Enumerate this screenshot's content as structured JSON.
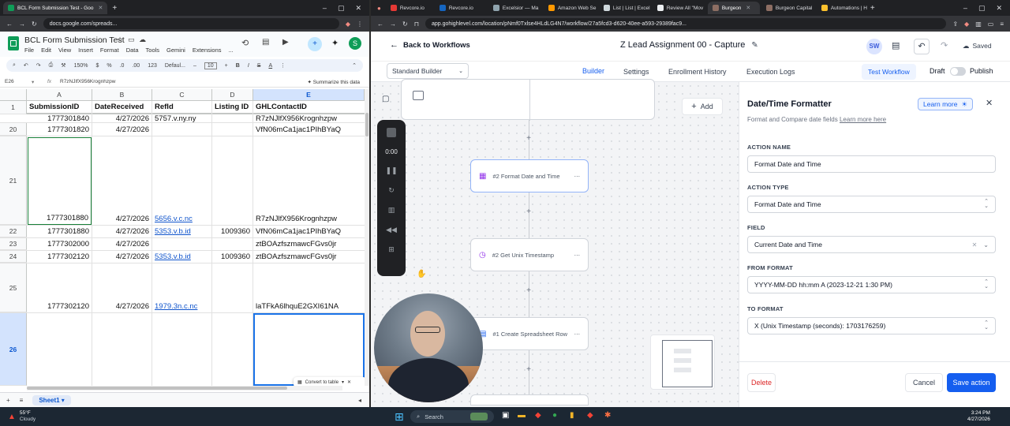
{
  "left_browser": {
    "tabs": [
      {
        "label": "BCL Form Submission Test - Goo",
        "active": true
      }
    ],
    "url": "docs.google.com/spreads..."
  },
  "sheets": {
    "doc_title": "BCL Form Submission Test",
    "menu": [
      "File",
      "Edit",
      "View",
      "Insert",
      "Format",
      "Data",
      "Tools",
      "Gemini",
      "Extensions",
      "..."
    ],
    "zoom": "150%",
    "currency": "$",
    "percent": "%",
    "decimals_down": ".0",
    "decimals_up": ".00",
    "number_format": "123",
    "font": "Defaul...",
    "font_size": "10",
    "bold": "B",
    "italic": "I",
    "strike": "S",
    "text_color": "A",
    "cell_ref": "E26",
    "formula": "R7zNJlfX956Krognhzpw",
    "summarize": "Summarize this data",
    "col_letters": [
      "A",
      "B",
      "C",
      "D",
      "E"
    ],
    "headers": [
      "SubmissionID",
      "DateReceived",
      "RefId",
      "Listing ID",
      "GHLContactID"
    ],
    "rows": [
      {
        "num": "20",
        "a": "1777301820",
        "b": "4/27/2026",
        "c": "",
        "d": "",
        "e": "VfN06mCa1jac1PIhBYaQ"
      },
      {
        "num": "21",
        "a": "1777301880",
        "b": "4/27/2026",
        "c": "5656.v.c.nc",
        "d": "",
        "e": "R7zNJlfX956Krognhzpw"
      },
      {
        "num": "22",
        "a": "1777301880",
        "b": "4/27/2026",
        "c": "5353.v.b.id",
        "d": "1009360",
        "e": "VfN06mCa1jac1PIhBYaQ"
      },
      {
        "num": "23",
        "a": "1777302000",
        "b": "4/27/2026",
        "c": "",
        "d": "",
        "e": "ztBOAzfszmawcFGvs0jr"
      },
      {
        "num": "24",
        "a": "1777302120",
        "b": "4/27/2026",
        "c": "5353.v.b.id",
        "d": "1009360",
        "e": "ztBOAzfszmawcFGvs0jr"
      },
      {
        "num": "25",
        "a": "1777302120",
        "b": "4/27/2026",
        "c": "1979.3n.c.nc",
        "d": "",
        "e": "laTFkA6lhquE2GXI61NA"
      },
      {
        "num": "26",
        "a": "",
        "b": "",
        "c": "",
        "d": "",
        "e": ""
      }
    ],
    "partial_row": {
      "a": "1777301840",
      "b": "4/27/2026",
      "c": "5757.v.ny.ny",
      "e": "R7zNJlfX956Krognhzpw"
    },
    "header_row_num": "1",
    "convert_to_table": "Convert to table",
    "sheet_tab": "Sheet1"
  },
  "right_browser": {
    "tabs": [
      {
        "label": "Revcore.io"
      },
      {
        "label": "Revcore.io"
      },
      {
        "label": "Excelsior — Ma"
      },
      {
        "label": "Amazon Web Se"
      },
      {
        "label": "List | List | Excel"
      },
      {
        "label": "Review All \"Mov"
      },
      {
        "label": "Burgeon",
        "active": true
      },
      {
        "label": "Burgeon Capital"
      },
      {
        "label": "Automations | H"
      }
    ],
    "url": "app.gohighlevel.com/location/pNmf0Txlse4HLdLG4N7/workflow/27a5fcd3-d620-40ee-a593-29389fac9..."
  },
  "workflow": {
    "back": "Back to Workflows",
    "title": "Z Lead Assignment 00 - Capture",
    "avatar": "SW",
    "saved": "Saved",
    "builder_select": "Standard Builder",
    "tabs": [
      "Builder",
      "Settings",
      "Enrollment History",
      "Execution Logs"
    ],
    "active_tab": "Builder",
    "test_workflow": "Test Workflow",
    "draft": "Draft",
    "publish": "Publish",
    "add": "Add",
    "timer": "0:00",
    "nodes": [
      {
        "label": "#2 Format Date and Time",
        "icon": "calendar-icon"
      },
      {
        "label": "#2 Get Unix Timestamp",
        "icon": "clock-icon"
      },
      {
        "label": "#1 Create Spreadsheet Row",
        "icon": "sheet-icon"
      }
    ]
  },
  "panel": {
    "title": "Date/Time Formatter",
    "learn_more_btn": "Learn more",
    "desc": "Format and Compare date fields",
    "desc_link": "Learn more here",
    "action_name_label": "ACTION NAME",
    "action_name_value": "Format Date and Time",
    "action_type_label": "ACTION TYPE",
    "action_type_value": "Format Date and Time",
    "field_label": "FIELD",
    "field_value": "Current Date and Time",
    "from_label": "FROM FORMAT",
    "from_value": "YYYY-MM-DD hh:mm A (2023-12-21 1:30 PM)",
    "to_label": "TO FORMAT",
    "to_value": "X (Unix Timestamp (seconds): 1703176259)",
    "delete": "Delete",
    "cancel": "Cancel",
    "save": "Save action"
  },
  "taskbar": {
    "temp": "55°F",
    "weather": "Cloudy",
    "search": "Search",
    "time": "3:24 PM",
    "date": "4/27/2026"
  },
  "colors": {
    "ghl_blue": "#155eef",
    "sheets_green": "#0f9d58",
    "delete_red": "#dc2626"
  }
}
